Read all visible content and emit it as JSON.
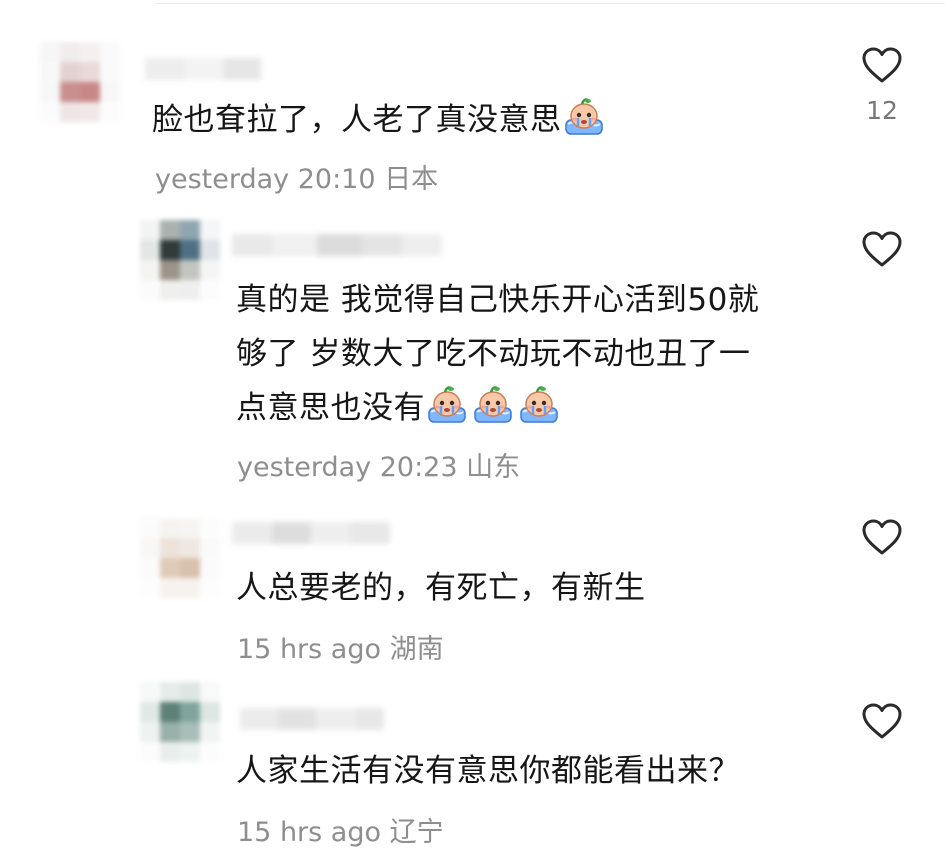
{
  "comments": [
    {
      "text": "脸也耷拉了，人老了真没意思",
      "emoji_count": 1,
      "time": "yesterday 20:10",
      "location": "日本",
      "likes": "12",
      "is_reply": false
    },
    {
      "text": "真的是 我觉得自己快乐开心活到50就够了 岁数大了吃不动玩不动也丑了一点意思也没有",
      "lines": [
        "真的是 我觉得自己快乐开心活到50就",
        "够了 岁数大了吃不动玩不动也丑了一",
        "点意思也没有"
      ],
      "emoji_count": 3,
      "time": "yesterday 20:23",
      "location": "山东",
      "likes": "",
      "is_reply": true
    },
    {
      "text": "人总要老的，有死亡，有新生",
      "emoji_count": 0,
      "time": "15 hrs ago",
      "location": "湖南",
      "likes": "",
      "is_reply": true
    },
    {
      "text": "人家生活有没有意思你都能看出来？",
      "emoji_count": 0,
      "time": "15 hrs ago",
      "location": "辽宁",
      "likes": "",
      "is_reply": true
    }
  ],
  "icons": {
    "like": "heart-outline-icon",
    "emoji": "crying-face-emoji"
  },
  "colors": {
    "text": "#161616",
    "meta": "#8e8e8e",
    "heart": "#2a2a2a"
  }
}
